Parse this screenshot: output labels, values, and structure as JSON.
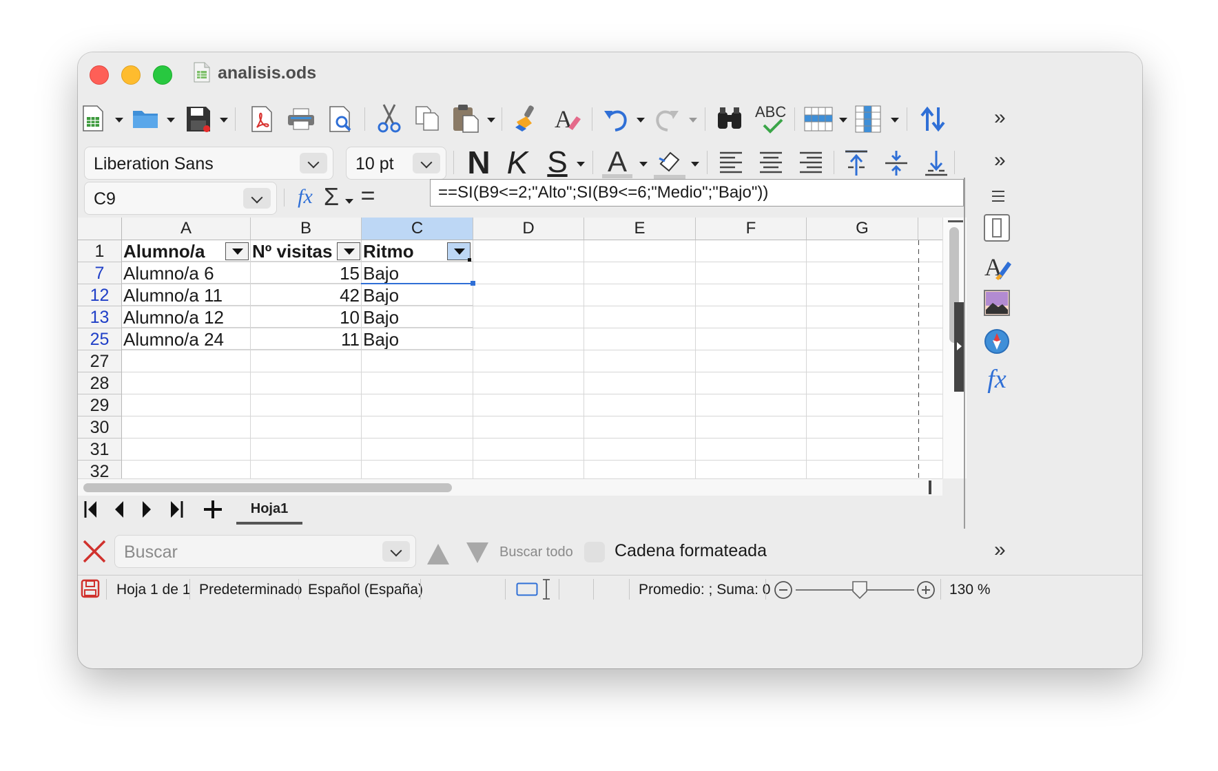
{
  "window": {
    "title": "analisis.ods"
  },
  "font_toolbar": {
    "font_name": "Liberation Sans",
    "font_size": "10 pt",
    "bold_glyph": "N",
    "italic_glyph": "K",
    "underline_glyph": "S",
    "font_color_glyph": "A"
  },
  "standard_toolbar": {
    "spellcheck_glyph": "ABC"
  },
  "formula_bar": {
    "cell_ref": "C9",
    "fx": "fx",
    "sum_glyph": "Σ",
    "equals_glyph": "=",
    "formula": "==SI(B9<=2;\"Alto\";SI(B9<=6;\"Medio\";\"Bajo\"))"
  },
  "grid": {
    "columns": [
      "A",
      "B",
      "C",
      "D",
      "E",
      "F",
      "G"
    ],
    "selected_column": "C",
    "header_row": {
      "row": "1",
      "cells": [
        "Alumno/a",
        "Nº visitas",
        "Ritmo"
      ]
    },
    "rows": [
      {
        "row": "7",
        "a": "Alumno/a 6",
        "b": "15",
        "c": "Bajo"
      },
      {
        "row": "12",
        "a": "Alumno/a 11",
        "b": "42",
        "c": "Bajo"
      },
      {
        "row": "13",
        "a": "Alumno/a 12",
        "b": "10",
        "c": "Bajo"
      },
      {
        "row": "25",
        "a": "Alumno/a 24",
        "b": "11",
        "c": "Bajo"
      }
    ],
    "empty_rows": [
      "27",
      "28",
      "29",
      "30",
      "31",
      "32"
    ]
  },
  "sheet_tabs": {
    "active": "Hoja1"
  },
  "find_bar": {
    "placeholder": "Buscar",
    "find_all": "Buscar todo",
    "formatted_label": "Cadena formateada"
  },
  "status_bar": {
    "sheet": "Hoja 1 de 1",
    "page_style": "Predeterminado",
    "language": "Español (España)",
    "summary": "Promedio: ; Suma: 0",
    "zoom": "130 %",
    "zoom_level_percent": 130
  },
  "colors": {
    "accent_blue": "#2f6fd6",
    "selected_header": "#bdd7f5",
    "filtered_row_number": "#1f3fc7"
  }
}
